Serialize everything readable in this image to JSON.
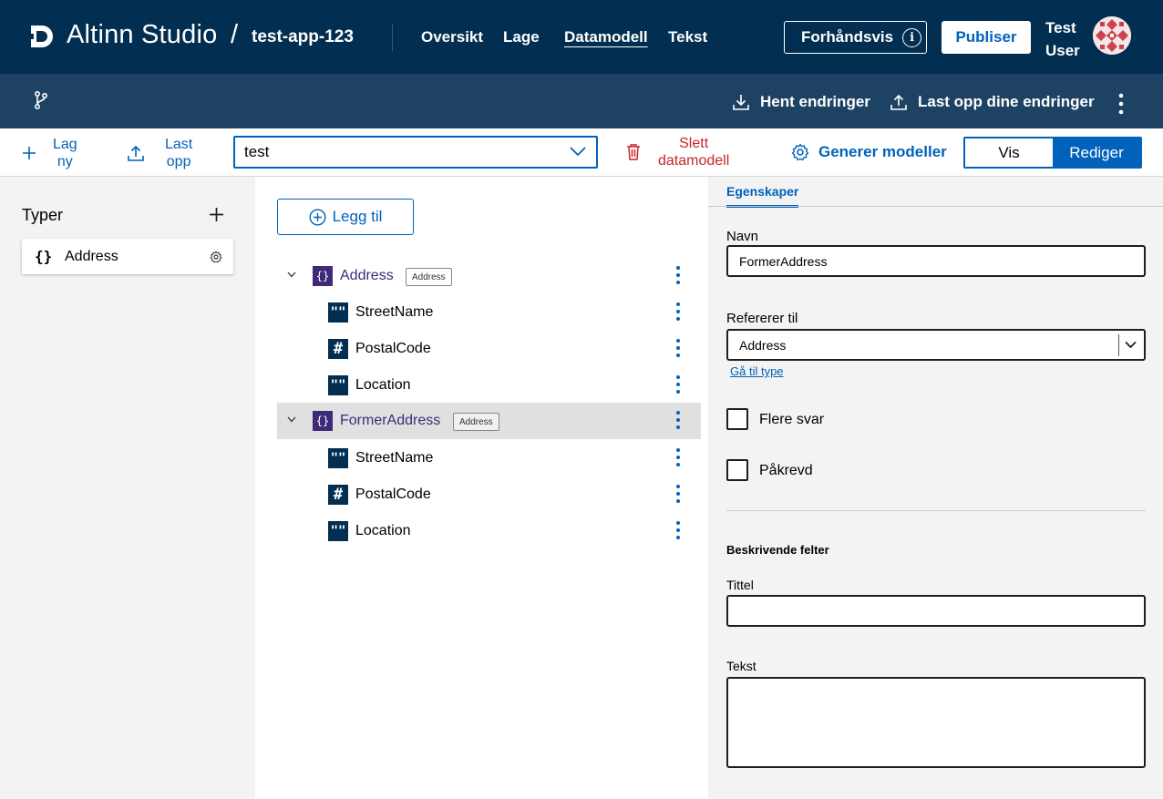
{
  "header": {
    "brand": "Altinn Studio",
    "separator": "/",
    "app_name": "test-app-123",
    "nav": [
      "Oversikt",
      "Lage",
      "Datamodell",
      "Tekst"
    ],
    "active_nav": "Datamodell",
    "preview_label": "Forhåndsvis",
    "publish_label": "Publiser",
    "user_first": "Test",
    "user_last": "User"
  },
  "subheader": {
    "fetch_label": "Hent endringer",
    "upload_label": "Last opp dine endringer"
  },
  "toolbar": {
    "create_new_l1": "Lag",
    "create_new_l2": "ny",
    "upload_l1": "Last",
    "upload_l2": "opp",
    "model_value": "test",
    "delete_l1": "Slett",
    "delete_l2": "datamodell",
    "generate_label": "Generer modeller",
    "view_label": "Vis",
    "edit_label": "Rediger",
    "active_mode": "Rediger"
  },
  "types_panel": {
    "title": "Typer",
    "types": [
      {
        "label": "Address",
        "icon": "braces-icon"
      }
    ]
  },
  "tree": {
    "add_label": "Legg til",
    "nodes": [
      {
        "name": "Address",
        "badge": "Address",
        "kind": "object",
        "selected": false
      },
      {
        "name": "StreetName",
        "kind": "string"
      },
      {
        "name": "PostalCode",
        "kind": "number"
      },
      {
        "name": "Location",
        "kind": "string"
      },
      {
        "name": "FormerAddress",
        "badge": "Address",
        "kind": "object",
        "selected": true
      },
      {
        "name": "StreetName",
        "kind": "string"
      },
      {
        "name": "PostalCode",
        "kind": "number"
      },
      {
        "name": "Location",
        "kind": "string"
      }
    ]
  },
  "properties": {
    "tab_label": "Egenskaper",
    "name_label": "Navn",
    "name_value": "FormerAddress",
    "ref_label": "Refererer til",
    "ref_value": "Address",
    "goto_type_label": "Gå til type",
    "multi_label": "Flere svar",
    "required_label": "Påkrevd",
    "desc_section": "Beskrivende felter",
    "title_label": "Tittel",
    "title_value": "",
    "text_label": "Tekst",
    "text_value": ""
  },
  "colors": {
    "header_bg": "#022f51",
    "subheader_bg": "#1e4264",
    "accent": "#0062ba",
    "danger": "#c8252b",
    "object_icon": "#3f2a7a"
  }
}
